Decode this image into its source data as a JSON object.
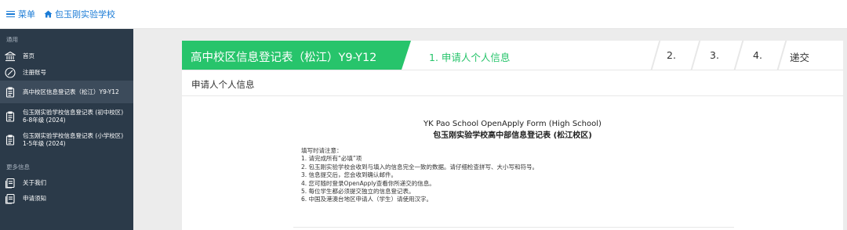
{
  "topbar": {
    "menu_label": "菜单",
    "school_name": "包玉刚实验学校"
  },
  "sidebar": {
    "section_general": "通用",
    "section_more": "更多信息",
    "items": [
      {
        "label": "首页",
        "icon": "bank-icon"
      },
      {
        "label": "注册账号",
        "icon": "compass-icon"
      },
      {
        "label": "高中校区信息登记表（松江）Y9-Y12",
        "icon": "clipboard-icon",
        "active": true
      },
      {
        "label": "包玉刚实验学校信息登记表 (初中校区) 6-8年级 (2024)",
        "icon": "clipboard-icon"
      },
      {
        "label": "包玉刚实验学校信息登记表 (小学校区) 1-5年级 (2024)",
        "icon": "clipboard-icon"
      }
    ],
    "more_items": [
      {
        "label": "关于我们",
        "icon": "document-icon"
      },
      {
        "label": "申请须知",
        "icon": "document-icon"
      }
    ]
  },
  "wizard": {
    "title": "高中校区信息登记表（松江）Y9-Y12",
    "active_step": "1. 申请人个人信息",
    "step2": "2.",
    "step3": "3.",
    "step4": "4.",
    "submit": "递交",
    "accent_color": "#27c46b"
  },
  "section": {
    "heading": "申请人个人信息"
  },
  "form": {
    "title_en": "YK Pao School OpenApply Form (High School)",
    "title_cn": "包玉刚实验学校高中部信息登记表 (松江校区)",
    "notes_heading": "填写时请注意：",
    "notes": [
      "1. 请完成所有“必填”项",
      "2. 包玉刚实验学校会收到与填入的信息完全一致的数据。请仔细检查拼写、大小写和符号。",
      "3. 信息提交后，您会收到确认邮件。",
      "4. 您可随时登录OpenApply查看你所递交的信息。",
      "5. 每位学生都必须提交独立的信息登记表。",
      "6. 中国及港澳台地区申请人（学生）请使用汉字。"
    ]
  }
}
